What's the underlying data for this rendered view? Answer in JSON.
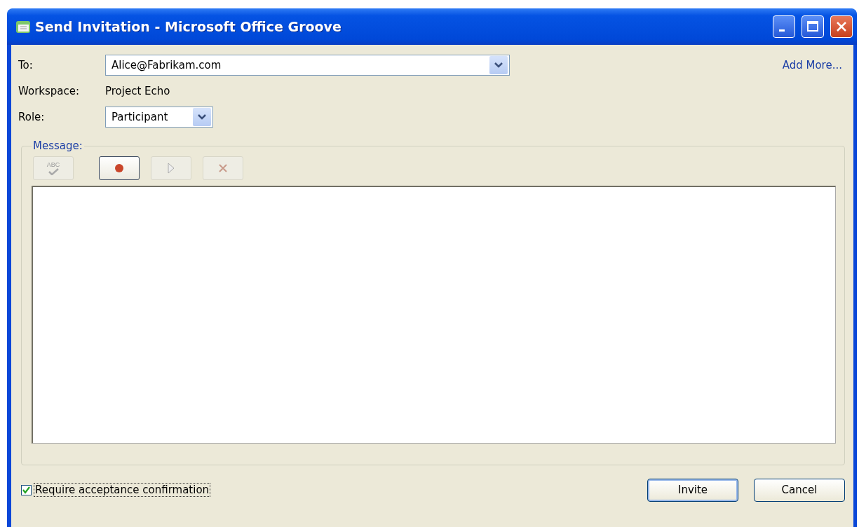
{
  "window": {
    "title": "Send Invitation - Microsoft Office Groove"
  },
  "to": {
    "label": "To:",
    "value": "Alice@Fabrikam.com"
  },
  "add_more": "Add More...",
  "workspace": {
    "label": "Workspace:",
    "value": "Project Echo"
  },
  "role": {
    "label": "Role:",
    "value": "Participant"
  },
  "message": {
    "label": "Message:",
    "toolbar": [
      {
        "kind": "spellcheck",
        "text": "ABC",
        "disabled": true
      },
      {
        "kind": "record",
        "disabled": false
      },
      {
        "kind": "play",
        "disabled": true
      },
      {
        "kind": "delete",
        "disabled": true
      }
    ]
  },
  "require_confirmation": {
    "label": "Require acceptance confirmation",
    "checked": true
  },
  "buttons": [
    {
      "label": "Invite",
      "default": true
    },
    {
      "label": "Cancel",
      "default": false
    }
  ]
}
